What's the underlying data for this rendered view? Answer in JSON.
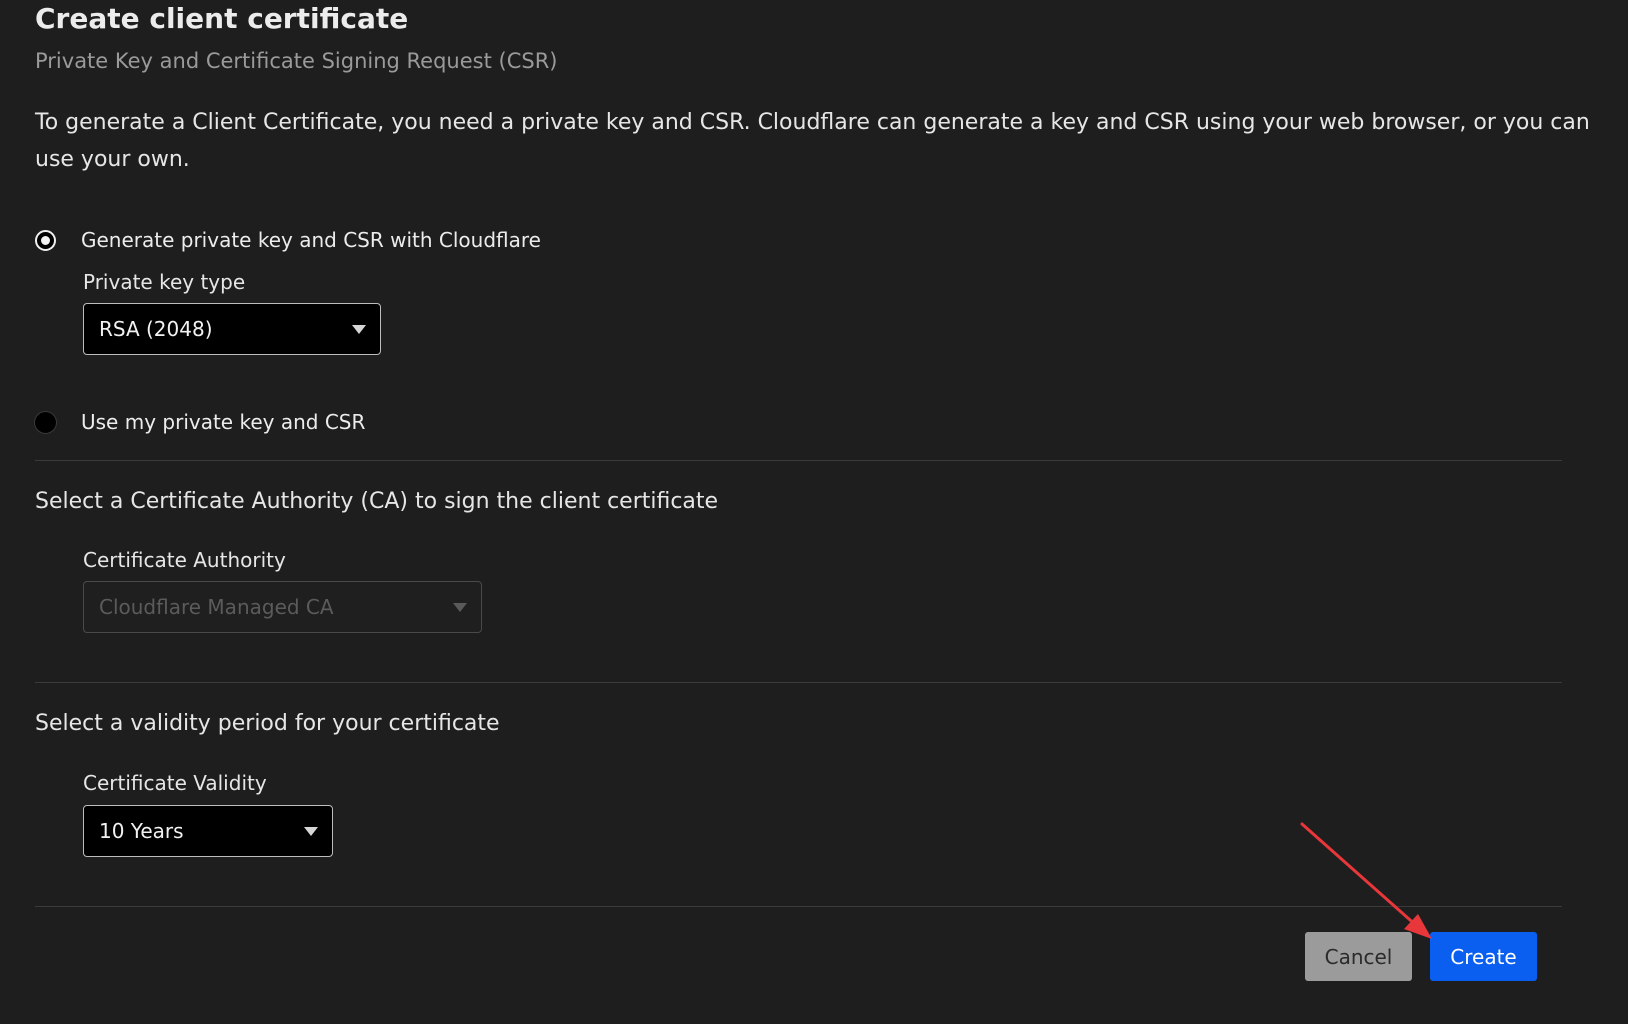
{
  "header": {
    "title": "Create client certificate",
    "subtitle": "Private Key and Certificate Signing Request (CSR)"
  },
  "intro": "To generate a Client Certificate, you need a private key and CSR. Cloudflare can generate a key and CSR using your web browser, or you can use your own.",
  "key_options": {
    "generate_label": "Generate private key and CSR with Cloudflare",
    "generate_selected": true,
    "own_label": "Use my private key and CSR",
    "own_selected": false
  },
  "private_key_type": {
    "label": "Private key type",
    "value": "RSA (2048)"
  },
  "ca_section": {
    "heading": "Select a Certificate Authority (CA) to sign the client certificate",
    "label": "Certificate Authority",
    "value": "Cloudflare Managed CA",
    "disabled": true
  },
  "validity_section": {
    "heading": "Select a validity period for your certificate",
    "label": "Certificate Validity",
    "value": "10 Years"
  },
  "actions": {
    "cancel_label": "Cancel",
    "create_label": "Create"
  },
  "colors": {
    "background": "#1e1e1f",
    "primary": "#0a5ff0",
    "annotation": "#e8373b"
  }
}
